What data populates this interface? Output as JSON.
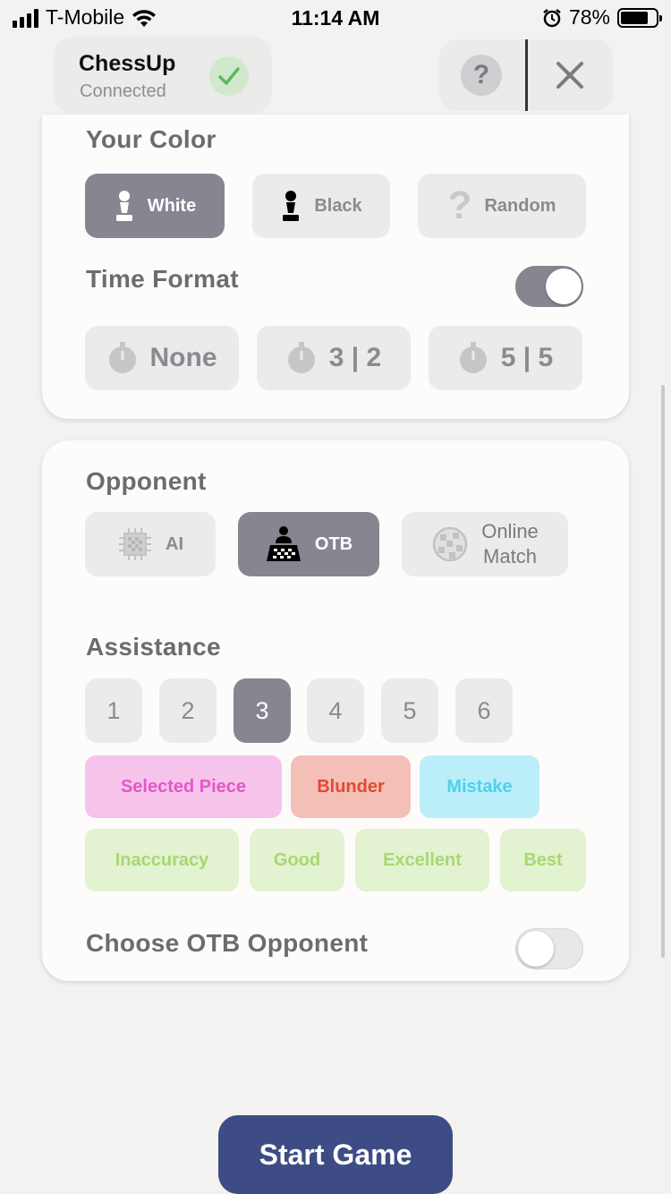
{
  "status_bar": {
    "carrier": "T-Mobile",
    "time": "11:14 AM",
    "battery": "78%",
    "battery_level": 0.78
  },
  "header": {
    "device_name": "ChessUp",
    "device_status": "Connected",
    "help_label": "?",
    "status_icon": "check-icon",
    "close_icon": "close-icon"
  },
  "your_color": {
    "title": "Your Color",
    "options": [
      {
        "label": "White",
        "icon": "white-pawn-icon",
        "selected": true
      },
      {
        "label": "Black",
        "icon": "black-pawn-icon",
        "selected": false
      },
      {
        "label": "Random",
        "icon": "question-icon",
        "selected": false
      }
    ]
  },
  "time_format": {
    "title": "Time Format",
    "enabled": true,
    "options": [
      "None",
      "3 | 2",
      "5 | 5"
    ]
  },
  "opponent": {
    "title": "Opponent",
    "options": [
      {
        "label": "AI",
        "icon": "chip-icon",
        "selected": false
      },
      {
        "label": "OTB",
        "icon": "chessboard-player-icon",
        "selected": true
      },
      {
        "label": "Online",
        "label2": "Match",
        "icon": "globe-icon",
        "selected": false
      }
    ]
  },
  "assistance": {
    "title": "Assistance",
    "levels": [
      "1",
      "2",
      "3",
      "4",
      "5",
      "6"
    ],
    "selected_level": "3",
    "tags": [
      {
        "label": "Selected Piece",
        "bg": "#f6c3ea",
        "color": "#e457c8"
      },
      {
        "label": "Blunder",
        "bg": "#f4bfb7",
        "color": "#e24a33"
      },
      {
        "label": "Mistake",
        "bg": "#bbeef8",
        "color": "#4fd0ec"
      },
      {
        "label": "Inaccuracy",
        "bg": "#e3f2d0",
        "color": "#a7d870"
      },
      {
        "label": "Good",
        "bg": "#e3f2d0",
        "color": "#a7d870"
      },
      {
        "label": "Excellent",
        "bg": "#e3f2d0",
        "color": "#a7d870"
      },
      {
        "label": "Best",
        "bg": "#e3f2d0",
        "color": "#a7d870"
      }
    ]
  },
  "otb_opponent": {
    "title": "Choose OTB Opponent",
    "enabled": false
  },
  "start_button": "Start Game",
  "colors": {
    "accent": "#3d4c84",
    "selected": "#868690",
    "connected": "#5cb85c"
  }
}
